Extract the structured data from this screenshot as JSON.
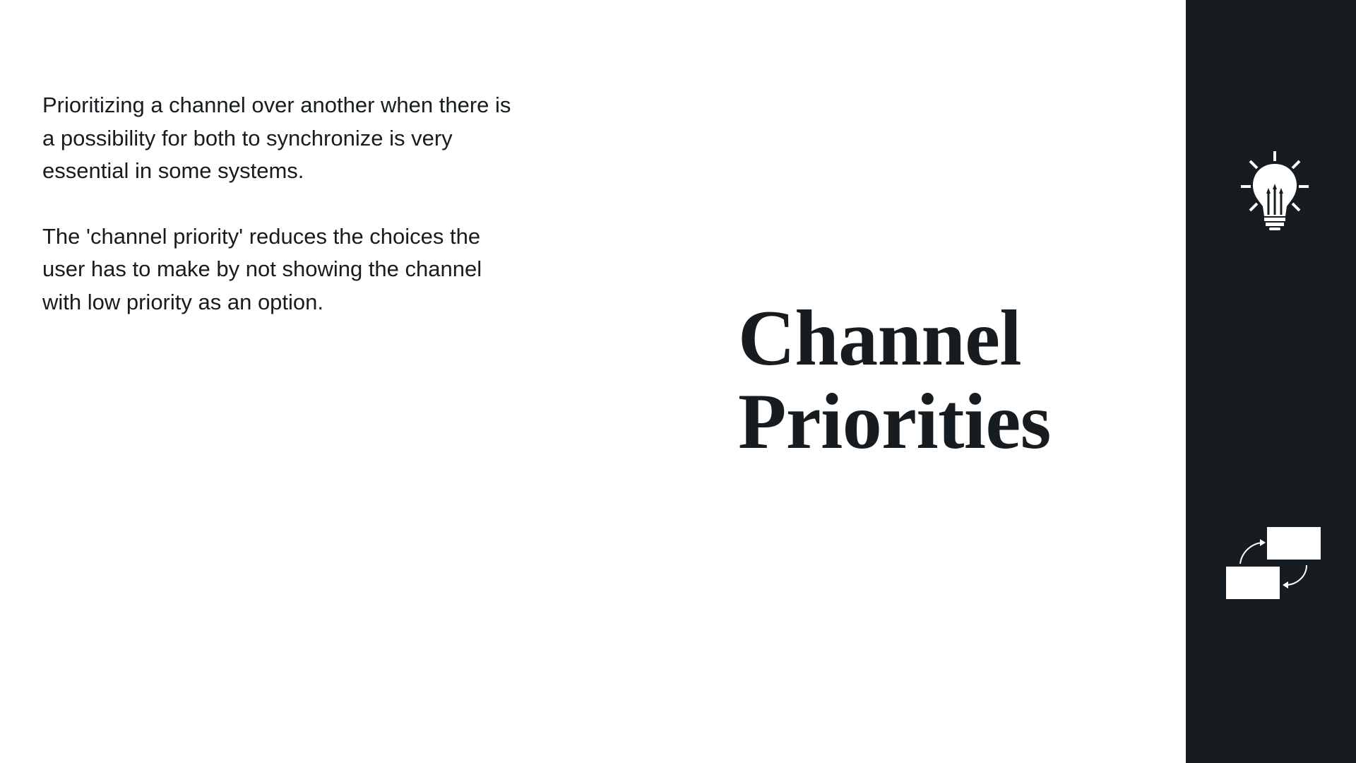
{
  "slide": {
    "paragraphs": [
      "Prioritizing a channel over another when there is a possibility for both to synchronize is very essential in some systems.",
      "The 'channel priority' reduces the choices the user has to make by not showing the channel with low priority as an option."
    ],
    "title_line_1": "Channel",
    "title_line_2": "Priorities"
  },
  "colors": {
    "background": "#ffffff",
    "text": "#161c1f",
    "sidebar": "#161c1f",
    "icon": "#ffffff"
  },
  "icons": {
    "top": "lightbulb-icon",
    "bottom": "swap-icon"
  }
}
